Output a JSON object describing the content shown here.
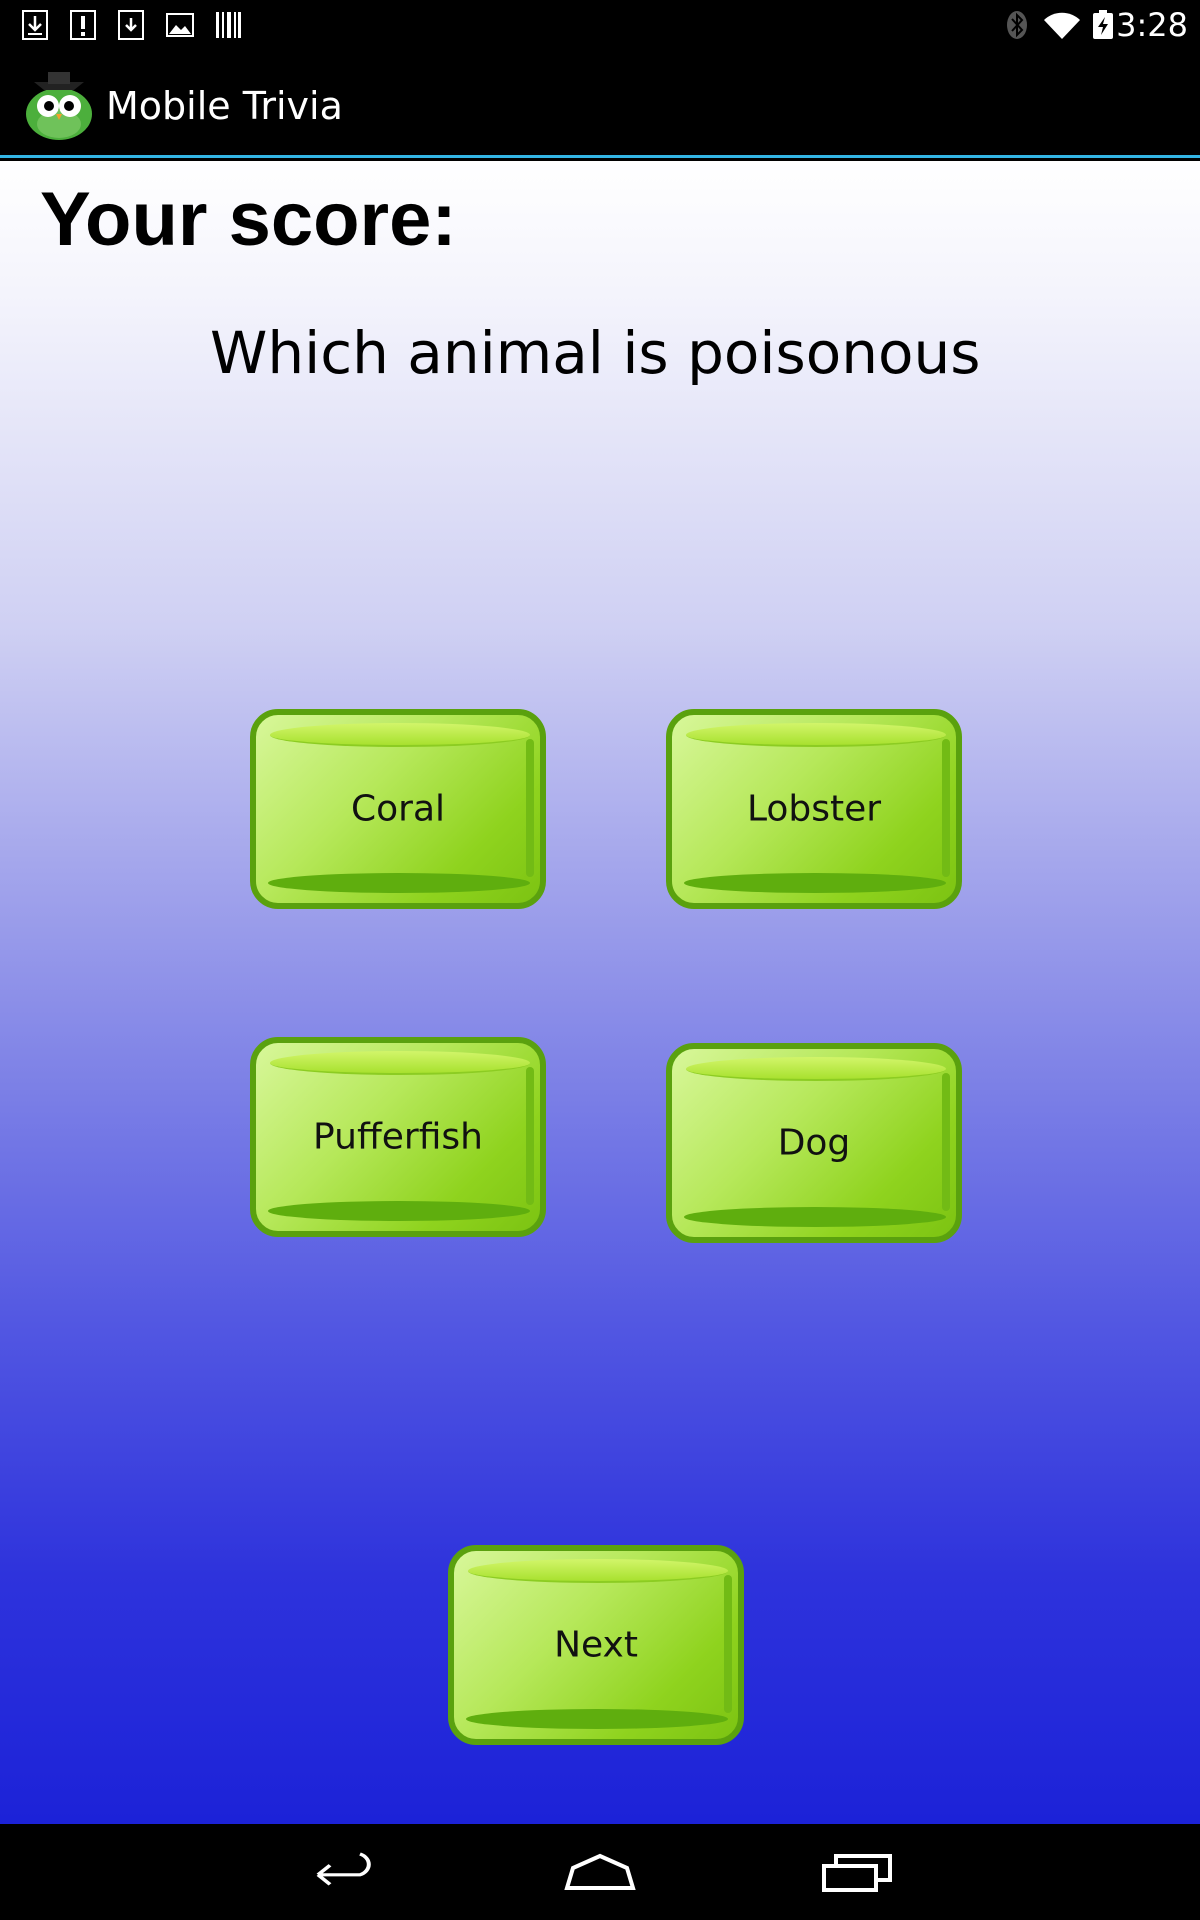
{
  "status_bar": {
    "time": "3:28",
    "left_icons": [
      "download-icon",
      "alert-icon",
      "download-icon",
      "image-icon",
      "barcode-icon"
    ],
    "right_icons": [
      "bluetooth-icon",
      "wifi-icon",
      "battery-charging-icon"
    ]
  },
  "action_bar": {
    "title": "Mobile Trivia",
    "icon": "owl-icon",
    "divider_color": "#33b5e5"
  },
  "quiz": {
    "score_label": "Your score:",
    "question": "Which animal is poisonous",
    "answers": [
      "Coral",
      "Lobster",
      "Pufferfish",
      "Dog"
    ],
    "next_label": "Next"
  },
  "nav_bar": {
    "icons": [
      "back-icon",
      "home-icon",
      "recents-icon"
    ]
  },
  "colors": {
    "button_green": "#8fd31e",
    "button_border": "#5aa10e",
    "gradient_top": "#ffffff",
    "gradient_bottom": "#1c22d8"
  }
}
